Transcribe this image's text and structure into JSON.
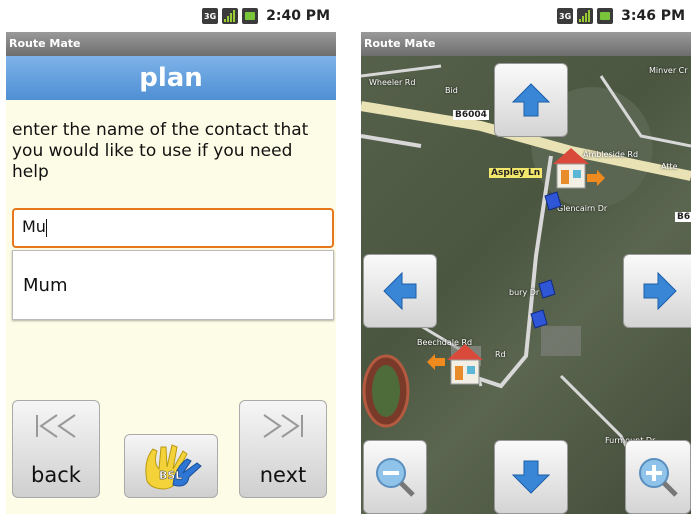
{
  "left": {
    "status": {
      "network": "3G",
      "time": "2:40 PM"
    },
    "app_title": "Route Mate",
    "header": "plan",
    "prompt": "enter the name of the contact that you would like to use if you need help",
    "input_value": "Mu",
    "suggestion": "Mum",
    "back_label": "back",
    "next_label": "next",
    "bsl_label": "BSL"
  },
  "right": {
    "status": {
      "network": "3G",
      "time": "3:46 PM"
    },
    "app_title": "Route Mate",
    "map_labels": {
      "road1": "B6004",
      "road2": "Aspley Ln",
      "road3": "B6"
    },
    "streets": [
      "Wheeler Rd",
      "Bid",
      "Ambleside Rd",
      "Minver Cr",
      "Glencairn Dr",
      "Beechdale Rd",
      "Rd",
      "Furmount Dr",
      "Atte",
      "bury Dr"
    ]
  },
  "colors": {
    "accent_orange": "#e7771c",
    "header_blue": "#4f8fd4",
    "panel_bg": "#fdfce6"
  }
}
